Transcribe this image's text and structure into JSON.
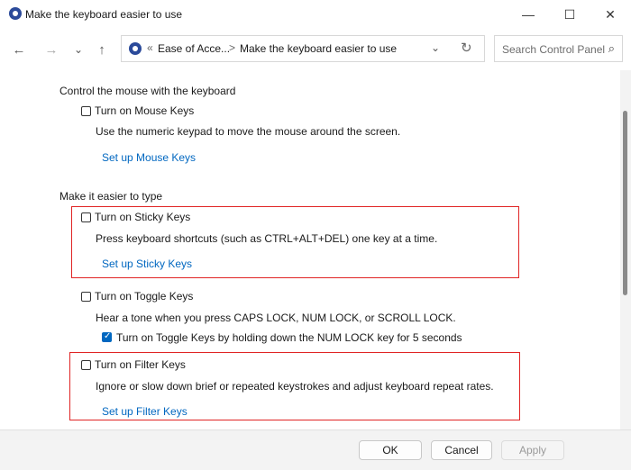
{
  "window": {
    "title": "Make the keyboard easier to use",
    "icon": "control-panel-icon",
    "controls": {
      "minimize": "—",
      "maximize": "☐",
      "close": "✕"
    }
  },
  "nav": {
    "back": "←",
    "forward": "→",
    "recent": "⌄",
    "up": "↑",
    "breadcrumb_chevron": "«",
    "breadcrumb": [
      "Ease of Acce...",
      "Make the keyboard easier to use"
    ],
    "breadcrumb_separator": ">",
    "dropdown": "⌄",
    "refresh": "↻",
    "search_placeholder": "Search Control Panel",
    "search_icon": "🔍"
  },
  "sections": {
    "mouse": {
      "heading": "Control the mouse with the keyboard",
      "option_label": "Turn on Mouse Keys",
      "option_checked": false,
      "description": "Use the numeric keypad to move the mouse around the screen.",
      "link": "Set up Mouse Keys"
    },
    "typing": {
      "heading": "Make it easier to type",
      "sticky": {
        "label": "Turn on Sticky Keys",
        "checked": false,
        "description": "Press keyboard shortcuts (such as CTRL+ALT+DEL) one key at a time.",
        "link": "Set up Sticky Keys"
      },
      "toggle": {
        "label": "Turn on Toggle Keys",
        "checked": false,
        "description": "Hear a tone when you press CAPS LOCK, NUM LOCK, or SCROLL LOCK.",
        "sub_label": "Turn on Toggle Keys by holding down the NUM LOCK key for 5 seconds",
        "sub_checked": true
      },
      "filter": {
        "label": "Turn on Filter Keys",
        "checked": false,
        "description": "Ignore or slow down brief or repeated keystrokes and adjust keyboard repeat rates.",
        "link": "Set up Filter Keys"
      }
    }
  },
  "footer": {
    "ok": "OK",
    "cancel": "Cancel",
    "apply": "Apply"
  },
  "colors": {
    "link": "#0067c0",
    "highlight_box": "#e02424",
    "checkbox_checked": "#0067c0"
  }
}
